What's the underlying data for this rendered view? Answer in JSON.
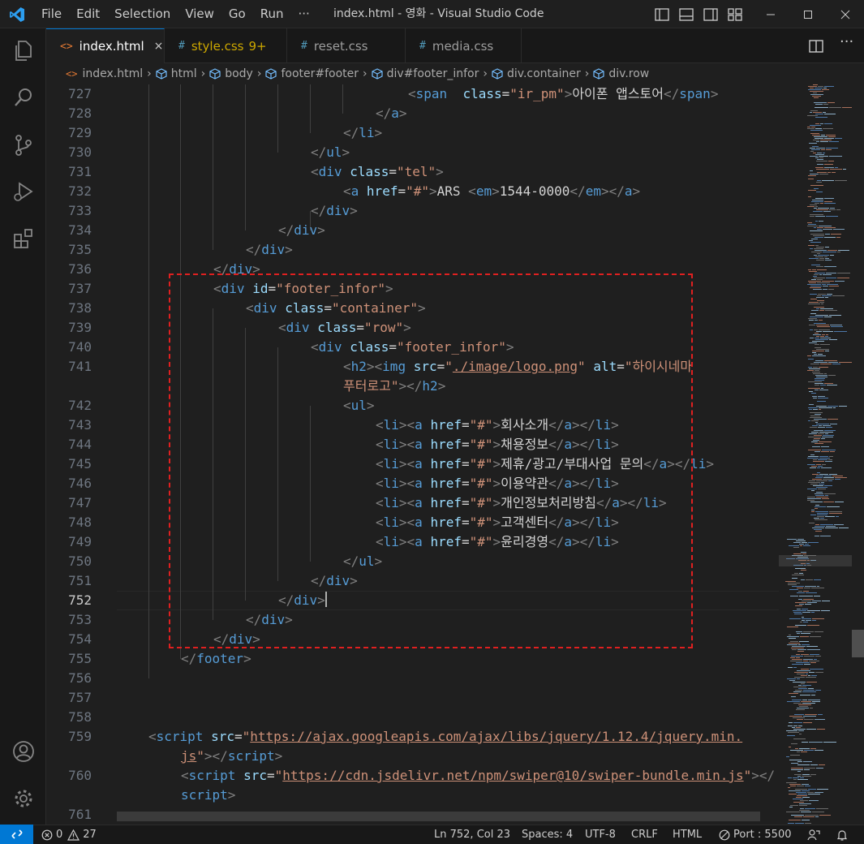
{
  "window": {
    "title": "index.html - 영화 - Visual Studio Code",
    "menu": [
      "File",
      "Edit",
      "Selection",
      "View",
      "Go",
      "Run",
      "···"
    ]
  },
  "tabs": [
    {
      "label": "index.html",
      "icon": "<>",
      "icon_color": "#e37933",
      "active": true,
      "close": "×"
    },
    {
      "label": "style.css",
      "icon": "#",
      "icon_color": "#519aba",
      "badge": "9+",
      "modified": true
    },
    {
      "label": "reset.css",
      "icon": "#",
      "icon_color": "#519aba"
    },
    {
      "label": "media.css",
      "icon": "#",
      "icon_color": "#519aba"
    }
  ],
  "breadcrumb": [
    "index.html",
    "html",
    "body",
    "footer#footer",
    "div#footer_infor",
    "div.container",
    "div.row"
  ],
  "editor": {
    "current_line": 752,
    "lines": [
      {
        "n": "727",
        "html": "<span class='tg'>&lt;</span><span class='tn'>span</span>  <span class='an'>class</span><span class='tx'>=</span><span class='av'>\"ir_pm\"</span><span class='tg'>&gt;</span>아이폰 앱스토어<span class='tg'>&lt;/</span><span class='tn'>span</span><span class='tg'>&gt;</span>"
      },
      {
        "n": "728",
        "html": "<span class='tg'>&lt;/</span><span class='tn'>a</span><span class='tg'>&gt;</span>"
      },
      {
        "n": "729",
        "html": "<span class='tg'>&lt;/</span><span class='tn'>li</span><span class='tg'>&gt;</span>"
      },
      {
        "n": "730",
        "html": "<span class='tg'>&lt;/</span><span class='tn'>ul</span><span class='tg'>&gt;</span>"
      },
      {
        "n": "731",
        "html": "<span class='tg'>&lt;</span><span class='tn'>div</span> <span class='an'>class</span>=<span class='av'>\"tel\"</span><span class='tg'>&gt;</span>"
      },
      {
        "n": "732",
        "html": "<span class='tg'>&lt;</span><span class='tn'>a</span> <span class='an'>href</span>=<span class='av'>\"#\"</span><span class='tg'>&gt;</span>ARS <span class='tg'>&lt;</span><span class='tn'>em</span><span class='tg'>&gt;</span>1544-0000<span class='tg'>&lt;/</span><span class='tn'>em</span><span class='tg'>&gt;&lt;/</span><span class='tn'>a</span><span class='tg'>&gt;</span>"
      },
      {
        "n": "733",
        "html": "<span class='tg'>&lt;/</span><span class='tn'>div</span><span class='tg'>&gt;</span>"
      },
      {
        "n": "734",
        "html": "<span class='tg'>&lt;/</span><span class='tn'>div</span><span class='tg'>&gt;</span>"
      },
      {
        "n": "735",
        "html": "<span class='tg'>&lt;/</span><span class='tn'>div</span><span class='tg'>&gt;</span>"
      },
      {
        "n": "736",
        "html": "<span class='tg'>&lt;/</span><span class='tn'>div</span><span class='tg'>&gt;</span>"
      },
      {
        "n": "737",
        "html": "<span class='tg'>&lt;</span><span class='tn'>div</span> <span class='an'>id</span>=<span class='av'>\"footer_infor\"</span><span class='tg'>&gt;</span>"
      },
      {
        "n": "738",
        "html": "<span class='tg'>&lt;</span><span class='tn'>div</span> <span class='an'>class</span>=<span class='av'>\"container\"</span><span class='tg'>&gt;</span>"
      },
      {
        "n": "739",
        "html": "<span class='tg'>&lt;</span><span class='tn'>div</span> <span class='an'>class</span>=<span class='av'>\"row\"</span><span class='tg'>&gt;</span>"
      },
      {
        "n": "740",
        "html": "<span class='tg'>&lt;</span><span class='tn'>div</span> <span class='an'>class</span>=<span class='av'>\"footer_infor\"</span><span class='tg'>&gt;</span>"
      },
      {
        "n": "741",
        "html": "<span class='tg'>&lt;</span><span class='tn'>h2</span><span class='tg'>&gt;&lt;</span><span class='tn'>img</span> <span class='an'>src</span>=<span class='av'>\"<span class='ul'>./image/logo.png</span>\"</span> <span class='an'>alt</span>=<span class='av'>\"하이시네마</span>"
      },
      {
        "n": "",
        "html": "<span class='av'>푸터로고\"</span><span class='tg'>&gt;&lt;/</span><span class='tn'>h2</span><span class='tg'>&gt;</span>"
      },
      {
        "n": "742",
        "html": "<span class='tg'>&lt;</span><span class='tn'>ul</span><span class='tg'>&gt;</span>"
      },
      {
        "n": "743",
        "html": "<span class='tg'>&lt;</span><span class='tn'>li</span><span class='tg'>&gt;&lt;</span><span class='tn'>a</span> <span class='an'>href</span>=<span class='av'>\"#\"</span><span class='tg'>&gt;</span>회사소개<span class='tg'>&lt;/</span><span class='tn'>a</span><span class='tg'>&gt;&lt;/</span><span class='tn'>li</span><span class='tg'>&gt;</span>"
      },
      {
        "n": "744",
        "html": "<span class='tg'>&lt;</span><span class='tn'>li</span><span class='tg'>&gt;&lt;</span><span class='tn'>a</span> <span class='an'>href</span>=<span class='av'>\"#\"</span><span class='tg'>&gt;</span>채용정보<span class='tg'>&lt;/</span><span class='tn'>a</span><span class='tg'>&gt;&lt;/</span><span class='tn'>li</span><span class='tg'>&gt;</span>"
      },
      {
        "n": "745",
        "html": "<span class='tg'>&lt;</span><span class='tn'>li</span><span class='tg'>&gt;&lt;</span><span class='tn'>a</span> <span class='an'>href</span>=<span class='av'>\"#\"</span><span class='tg'>&gt;</span>제휴/광고/부대사업 문의<span class='tg'>&lt;/</span><span class='tn'>a</span><span class='tg'>&gt;&lt;/</span><span class='tn'>li</span><span class='tg'>&gt;</span>"
      },
      {
        "n": "746",
        "html": "<span class='tg'>&lt;</span><span class='tn'>li</span><span class='tg'>&gt;&lt;</span><span class='tn'>a</span> <span class='an'>href</span>=<span class='av'>\"#\"</span><span class='tg'>&gt;</span>이용약관<span class='tg'>&lt;/</span><span class='tn'>a</span><span class='tg'>&gt;&lt;/</span><span class='tn'>li</span><span class='tg'>&gt;</span>"
      },
      {
        "n": "747",
        "html": "<span class='tg'>&lt;</span><span class='tn'>li</span><span class='tg'>&gt;&lt;</span><span class='tn'>a</span> <span class='an'>href</span>=<span class='av'>\"#\"</span><span class='tg'>&gt;</span>개인정보처리방침<span class='tg'>&lt;/</span><span class='tn'>a</span><span class='tg'>&gt;&lt;/</span><span class='tn'>li</span><span class='tg'>&gt;</span>"
      },
      {
        "n": "748",
        "html": "<span class='tg'>&lt;</span><span class='tn'>li</span><span class='tg'>&gt;&lt;</span><span class='tn'>a</span> <span class='an'>href</span>=<span class='av'>\"#\"</span><span class='tg'>&gt;</span>고객센터<span class='tg'>&lt;/</span><span class='tn'>a</span><span class='tg'>&gt;&lt;/</span><span class='tn'>li</span><span class='tg'>&gt;</span>"
      },
      {
        "n": "749",
        "html": "<span class='tg'>&lt;</span><span class='tn'>li</span><span class='tg'>&gt;&lt;</span><span class='tn'>a</span> <span class='an'>href</span>=<span class='av'>\"#\"</span><span class='tg'>&gt;</span>윤리경영<span class='tg'>&lt;/</span><span class='tn'>a</span><span class='tg'>&gt;&lt;/</span><span class='tn'>li</span><span class='tg'>&gt;</span>"
      },
      {
        "n": "750",
        "html": "<span class='tg'>&lt;/</span><span class='tn'>ul</span><span class='tg'>&gt;</span>"
      },
      {
        "n": "751",
        "html": "<span class='tg'>&lt;/</span><span class='tn'>div</span><span class='tg'>&gt;</span>"
      },
      {
        "n": "752",
        "html": "<span class='tg'>&lt;/</span><span class='tn'>div</span><span class='tg'>&gt;</span><span class='caret'></span>"
      },
      {
        "n": "753",
        "html": "<span class='tg'>&lt;/</span><span class='tn'>div</span><span class='tg'>&gt;</span>"
      },
      {
        "n": "754",
        "html": "<span class='tg'>&lt;/</span><span class='tn'>div</span><span class='tg'>&gt;</span>"
      },
      {
        "n": "755",
        "html": "<span class='tg'>&lt;/</span><span class='tn'>footer</span><span class='tg'>&gt;</span>"
      },
      {
        "n": "756",
        "html": ""
      },
      {
        "n": "757",
        "html": ""
      },
      {
        "n": "758",
        "html": ""
      },
      {
        "n": "759",
        "html": "<span class='tg'>&lt;</span><span class='tn'>script</span> <span class='an'>src</span>=<span class='av'>\"<span class='ul'>https://ajax.googleapis.com/ajax/libs/jquery/1.12.4/jquery.min.</span></span>"
      },
      {
        "n": "",
        "html": "<span class='av'><span class='ul'>js</span>\"</span><span class='tg'>&gt;&lt;/</span><span class='tn'>script</span><span class='tg'>&gt;</span>"
      },
      {
        "n": "760",
        "html": "<span class='tg'>&lt;</span><span class='tn'>script</span> <span class='an'>src</span>=<span class='av'>\"<span class='ul'>https://cdn.jsdelivr.net/npm/swiper@10/swiper-bundle.min.js</span>\"</span><span class='tg'>&gt;&lt;/</span>"
      },
      {
        "n": "",
        "html": "<span class='tn'>script</span><span class='tg'>&gt;</span>"
      },
      {
        "n": "761",
        "html": ""
      }
    ]
  },
  "status": {
    "errors": "0",
    "warnings": "27",
    "position": "Ln 752, Col 23",
    "spaces": "Spaces: 4",
    "encoding": "UTF-8",
    "eol": "CRLF",
    "language": "HTML",
    "port": "Port : 5500"
  },
  "colors": {
    "accent": "#0078d4",
    "highlight_box": "#e02020"
  }
}
